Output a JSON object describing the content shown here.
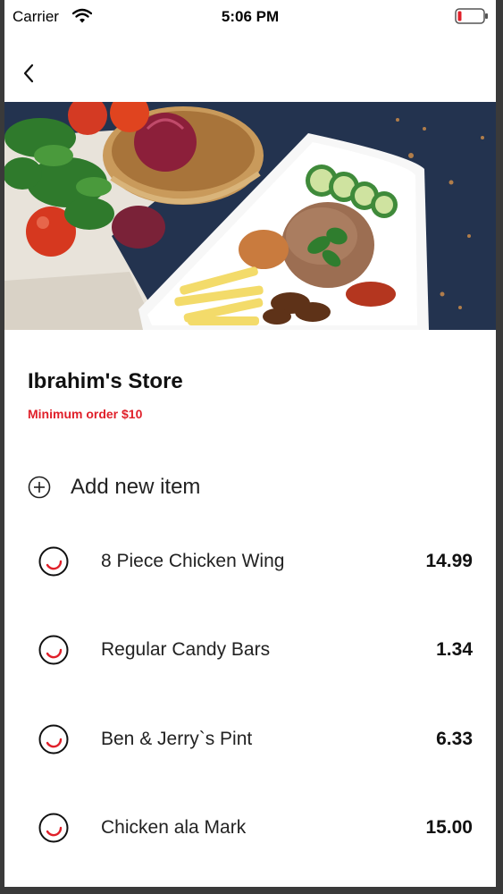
{
  "status_bar": {
    "carrier": "Carrier",
    "time": "5:06 PM",
    "icons": [
      "wifi-icon",
      "battery-icon"
    ],
    "battery_color": "#e0202a"
  },
  "nav": {
    "back_icon": "chevron-left-icon"
  },
  "store": {
    "name": "Ibrahim's Store",
    "minimum_order": "Minimum order $10",
    "accent_color": "#e0202a"
  },
  "add_item": {
    "label": "Add new item",
    "icon": "plus-circle-icon"
  },
  "items": [
    {
      "name": "8 Piece Chicken Wing",
      "price": "14.99"
    },
    {
      "name": "Regular Candy Bars",
      "price": "1.34"
    },
    {
      "name": "Ben & Jerry`s Pint",
      "price": "6.33"
    },
    {
      "name": "Chicken ala Mark",
      "price": "15.00"
    }
  ]
}
